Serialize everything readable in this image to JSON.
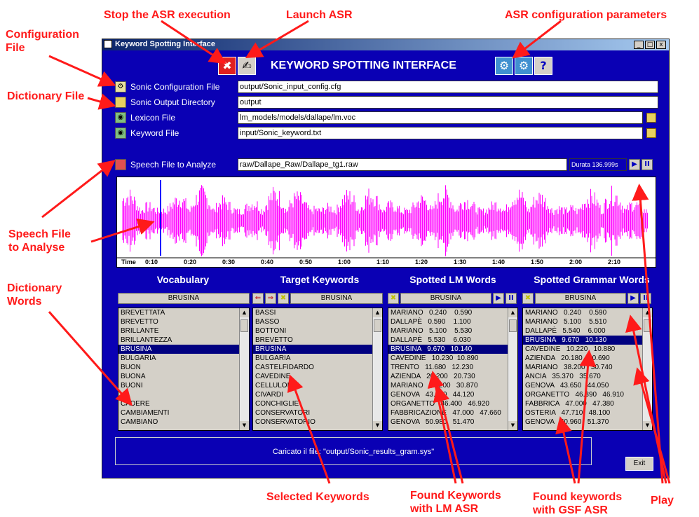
{
  "window": {
    "title": "Keyword Spotting Interface",
    "app_title": "KEYWORD SPOTTING INTERFACE",
    "controls": {
      "minimize": "_",
      "maximize": "□",
      "close": "x"
    }
  },
  "toolbar": {
    "stop_icon": "✖",
    "launch_icon": "✍",
    "config_icon": "⚙",
    "help_icon": "?"
  },
  "fields": {
    "sonic_config": {
      "label": "Sonic Configuration File",
      "value": "output/Sonic_input_config.cfg"
    },
    "sonic_output": {
      "label": "Sonic Output Directory",
      "value": "output"
    },
    "lexicon": {
      "label": "Lexicon File",
      "value": "lm_models/models/dallape/lm.voc"
    },
    "keyword": {
      "label": "Keyword File",
      "value": "input/Sonic_keyword.txt"
    },
    "speech": {
      "label": "Speech File to Analyze",
      "value": "raw/Dallape_Raw/Dallape_tg1.raw",
      "duration": "Durata 136.999s"
    }
  },
  "playback": {
    "play": "▶",
    "pause": "II"
  },
  "timeline": [
    "Time",
    "0:10",
    "0:20",
    "0:30",
    "0:40",
    "0:50",
    "1:00",
    "1:10",
    "1:20",
    "1:30",
    "1:40",
    "1:50",
    "2:00",
    "2:10"
  ],
  "columns": {
    "vocabulary": {
      "header": "Vocabulary",
      "selected": "BRUSINA",
      "items": [
        "BREVETTATA",
        "BREVETTO",
        "BRILLANTE",
        "BRILLANTEZZA",
        "BRUSINA",
        "BULGARIA",
        "BUON",
        "BUONA",
        "BUONI",
        "",
        "CADERE",
        "CAMBIAMENTI",
        "CAMBIANO"
      ],
      "selected_index": 4
    },
    "target": {
      "header": "Target Keywords",
      "selected": "BRUSINA",
      "items": [
        "BASSI",
        "BASSO",
        "BOTTONI",
        "BREVETTO",
        "BRUSINA",
        "BULGARIA",
        "CASTELFIDARDO",
        "CAVEDINE",
        "CELLULOIDE",
        "CIVARDI",
        "CONCHIGLIE",
        "CONSERVATORI",
        "CONSERVATORIO"
      ],
      "selected_index": 4
    },
    "lm": {
      "header": "Spotted LM Words",
      "selected": "BRUSINA",
      "items": [
        "MARIANO   0.240    0.590",
        "DALLAPÈ   0.590    1.100",
        "MARIANO   5.100    5.530",
        "DALLAPÈ   5.530    6.030",
        "BRUSINA   9.670   10.140",
        "CAVEDINE   10.230  10.890",
        "TRENTO   11.680   12.230",
        "AZIENDA   20.200   20.730",
        "MARIANO   30.200   30.870",
        "GENOVA   43.650   44.120",
        "ORGANETTO   46.400   46.920",
        "FABBRICAZIONE   47.000   47.660",
        "GENOVA   50.980   51.470"
      ],
      "selected_index": 4
    },
    "grammar": {
      "header": "Spotted Grammar Words",
      "selected": "BRUSINA",
      "items": [
        "MARIANO   0.240    0.590",
        "MARIANO   5.100    5.510",
        "DALLAPÈ   5.540    6.000",
        "BRUSINA   9.670   10.130",
        "CAVEDINE   10.220   10.880",
        "AZIENDA   20.180   20.690",
        "MARIANO   38.200   30.740",
        "ANCIA   35.370   35.670",
        "GENOVA   43.650   44.050",
        "ORGANETTO   46.390   46.910",
        "FABBRICA   47.000   47.380",
        "OSTERIA   47.710   48.100",
        "GENOVA   50.960   51.370"
      ],
      "selected_index": 3
    }
  },
  "status": "Caricato il file: \"output/Sonic_results_gram.sys\"",
  "exit_label": "Exit",
  "annotations": {
    "stop": "Stop the ASR execution",
    "launch": "Launch ASR",
    "asr_config": "ASR configuration parameters",
    "config_file": "Configuration\nFile",
    "dictionary_file": "Dictionary File",
    "speech_file": "Speech File\nto Analyse",
    "dictionary_words": "Dictionary\nWords",
    "selected_keywords": "Selected Keywords",
    "found_lm": "Found Keywords\nwith LM ASR",
    "found_gsf": "Found keywords\nwith GSF ASR",
    "play": "Play"
  },
  "colors": {
    "window_bg": "#0a00b4",
    "annotation": "#ff1a1a",
    "wave": "#ff00ff",
    "selection": "#000080"
  }
}
